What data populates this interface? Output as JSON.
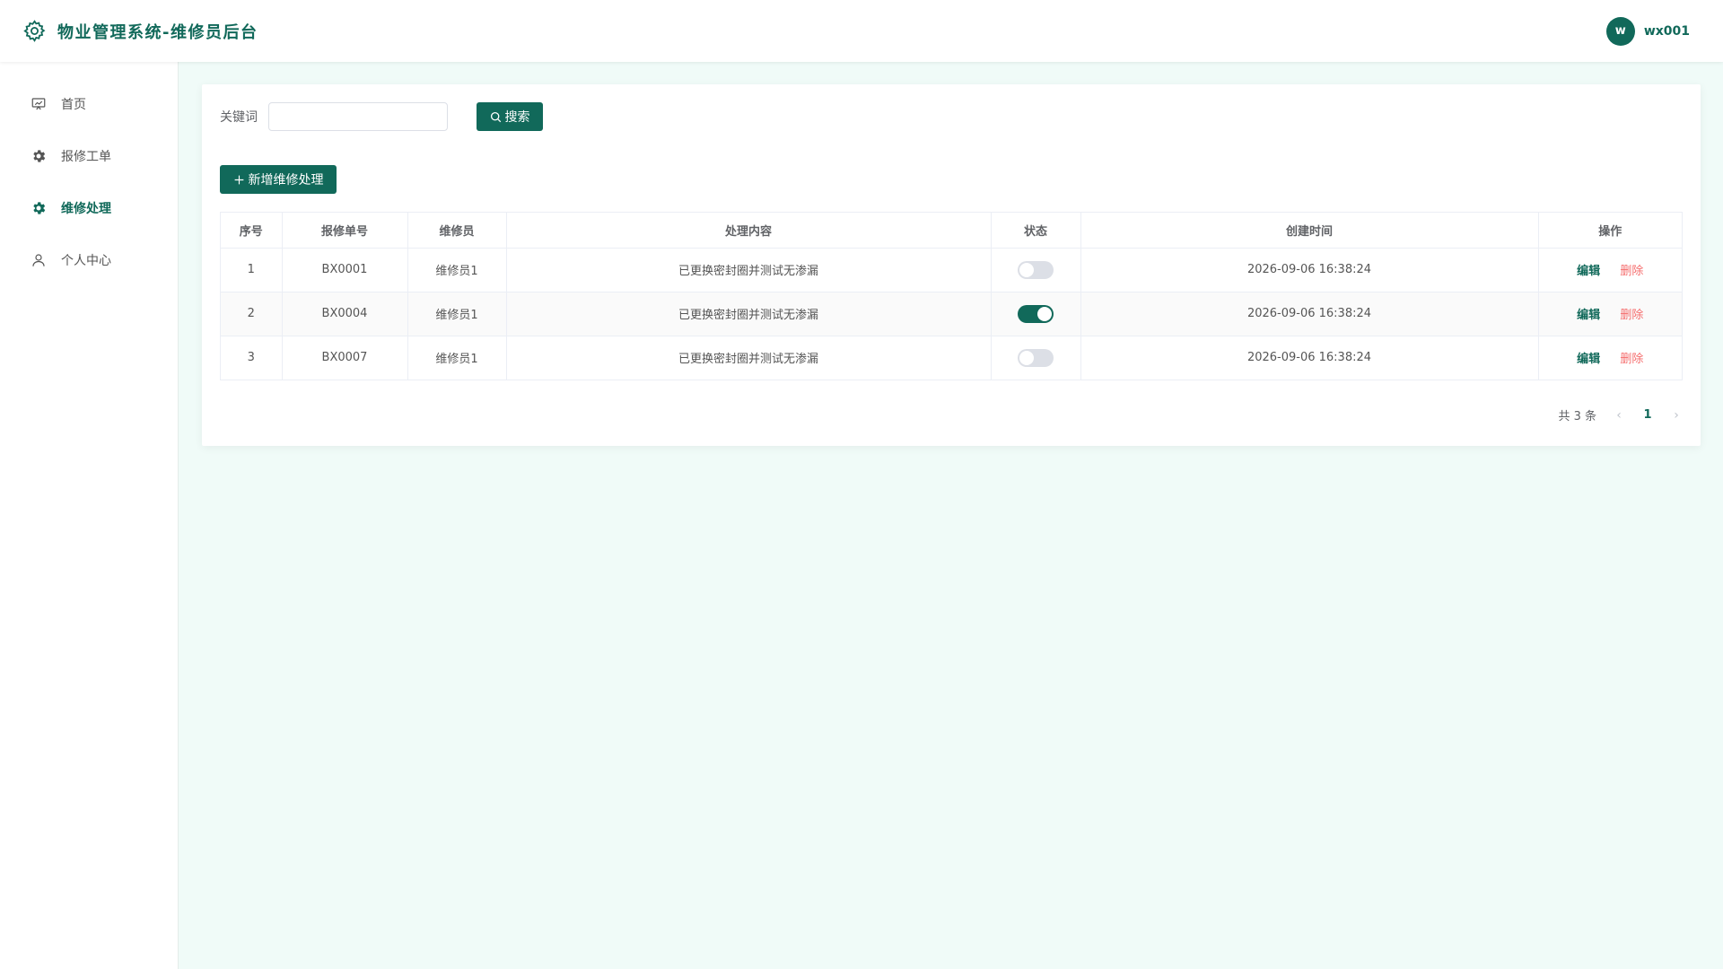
{
  "header": {
    "title": "物业管理系统-维修员后台",
    "avatar_letter": "w",
    "username": "wx001"
  },
  "sidebar": {
    "items": [
      {
        "label": "首页",
        "icon": "dashboard-icon",
        "active": false
      },
      {
        "label": "报修工单",
        "icon": "gear-icon",
        "active": false
      },
      {
        "label": "维修处理",
        "icon": "gear-icon",
        "active": true
      },
      {
        "label": "个人中心",
        "icon": "user-icon",
        "active": false
      }
    ]
  },
  "search": {
    "label": "关键词",
    "value": "",
    "placeholder": "",
    "button_label": "搜索"
  },
  "toolbar": {
    "add_label": "新增维修处理"
  },
  "table": {
    "columns": [
      "序号",
      "报修单号",
      "维修员",
      "处理内容",
      "状态",
      "创建时间",
      "操作"
    ],
    "rows": [
      {
        "index": "1",
        "order_no": "BX0001",
        "repairman": "维修员1",
        "content": "已更换密封圈并测试无渗漏",
        "status_on": false,
        "created": "2026-09-06 16:38:24",
        "edit": "编辑",
        "delete": "删除"
      },
      {
        "index": "2",
        "order_no": "BX0004",
        "repairman": "维修员1",
        "content": "已更换密封圈并测试无渗漏",
        "status_on": true,
        "created": "2026-09-06 16:38:24",
        "edit": "编辑",
        "delete": "删除"
      },
      {
        "index": "3",
        "order_no": "BX0007",
        "repairman": "维修员1",
        "content": "已更换密封圈并测试无渗漏",
        "status_on": false,
        "created": "2026-09-06 16:38:24",
        "edit": "编辑",
        "delete": "删除"
      }
    ]
  },
  "pagination": {
    "total_text": "共 3 条",
    "current_page": "1",
    "prev_icon": "chevron-left-icon",
    "next_icon": "chevron-right-icon"
  },
  "colors": {
    "primary": "#11695a",
    "danger": "#f56c6c",
    "background": "#f0fbf8"
  }
}
